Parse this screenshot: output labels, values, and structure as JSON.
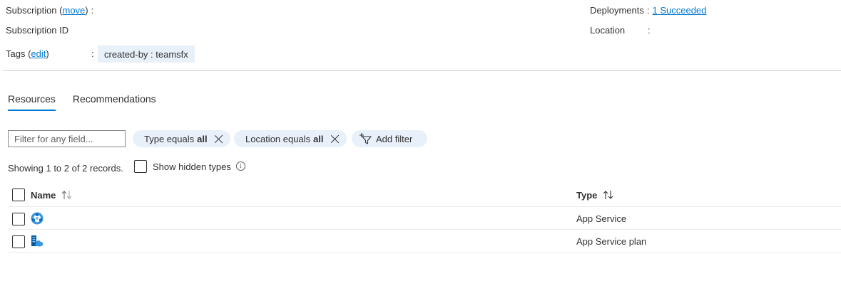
{
  "essentials": {
    "subscription_label": "Subscription",
    "subscription_move": "move",
    "subscription_id_label": "Subscription ID",
    "tags_label": "Tags",
    "tags_edit": "edit",
    "tag": "created-by : teamsfx",
    "deployments_label": "Deployments",
    "deployments_value": "1 Succeeded",
    "location_label": "Location",
    "colon": ":"
  },
  "tabs": [
    {
      "label": "Resources",
      "active": true
    },
    {
      "label": "Recommendations",
      "active": false
    }
  ],
  "filter": {
    "placeholder": "Filter for any field...",
    "type_pill": {
      "prefix": "Type equals",
      "value": "all"
    },
    "location_pill": {
      "prefix": "Location equals",
      "value": "all"
    },
    "add_filter": "Add filter"
  },
  "records_text": "Showing 1 to 2 of 2 records.",
  "show_hidden_label": "Show hidden types",
  "grid": {
    "columns": [
      "Name",
      "Type"
    ],
    "rows": [
      {
        "icon": "app-service-icon",
        "name": "",
        "type": "App Service"
      },
      {
        "icon": "app-service-plan-icon",
        "name": "",
        "type": "App Service plan"
      }
    ]
  },
  "colors": {
    "accent": "#0078d4",
    "pill_bg": "#e8f1fa",
    "divider": "#d2d0ce"
  }
}
